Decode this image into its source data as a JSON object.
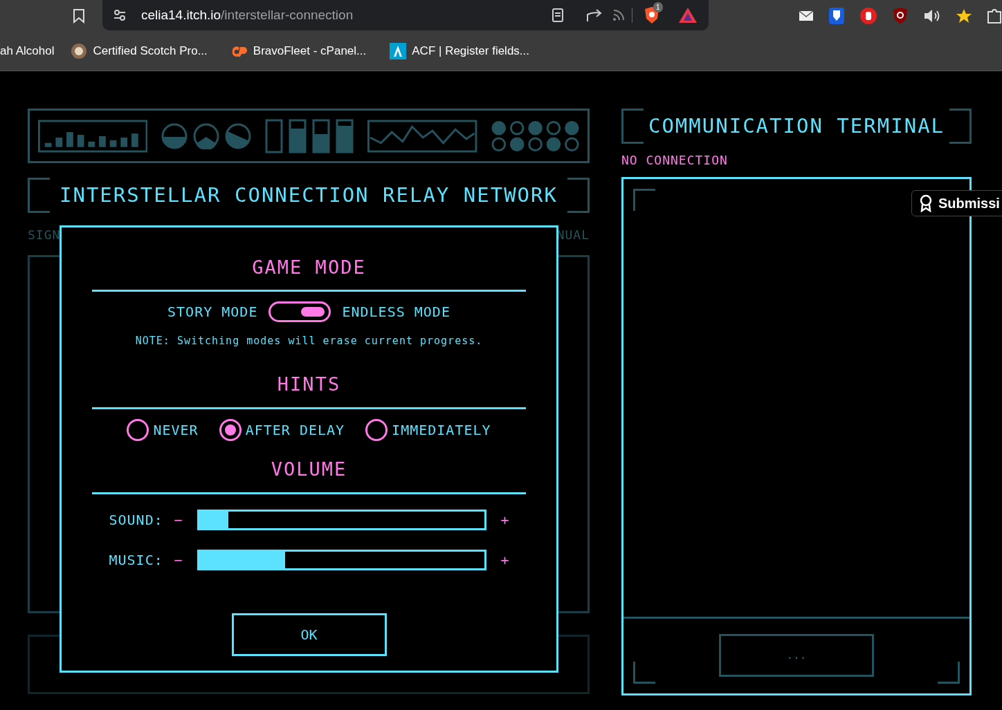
{
  "browser": {
    "url_host": "celia14.itch.io",
    "url_path": "/interstellar-connection",
    "shield_count": "1",
    "bookmarks": [
      "ah Alcohol",
      "Certified Scotch Pro...",
      "BravoFleet - cPanel...",
      "ACF | Register fields..."
    ]
  },
  "left_panel": {
    "title": "INTERSTELLAR CONNECTION RELAY NETWORK",
    "side_labels": [
      "SIGN",
      "NUAL"
    ]
  },
  "modal": {
    "sections": [
      {
        "kind": "toggle",
        "heading": "GAME MODE",
        "left_label": "STORY MODE",
        "right_label": "ENDLESS MODE",
        "on": true,
        "note": "NOTE: Switching modes will erase current progress."
      },
      {
        "kind": "radio",
        "heading": "HINTS",
        "options": [
          {
            "label": "NEVER",
            "selected": false
          },
          {
            "label": "AFTER DELAY",
            "selected": true
          },
          {
            "label": "IMMEDIATELY",
            "selected": false
          }
        ]
      },
      {
        "kind": "sliders",
        "heading": "VOLUME",
        "sliders": [
          {
            "label": "SOUND:",
            "minus": "−",
            "plus": "+",
            "level": 0.1
          },
          {
            "label": "MUSIC:",
            "minus": "−",
            "plus": "+",
            "level": 0.3
          }
        ]
      }
    ],
    "ok": "OK"
  },
  "terminal": {
    "title": "COMMUNICATION TERMINAL",
    "status": "NO CONNECTION",
    "send_button": "..."
  },
  "badge": {
    "label": "Submissi"
  }
}
